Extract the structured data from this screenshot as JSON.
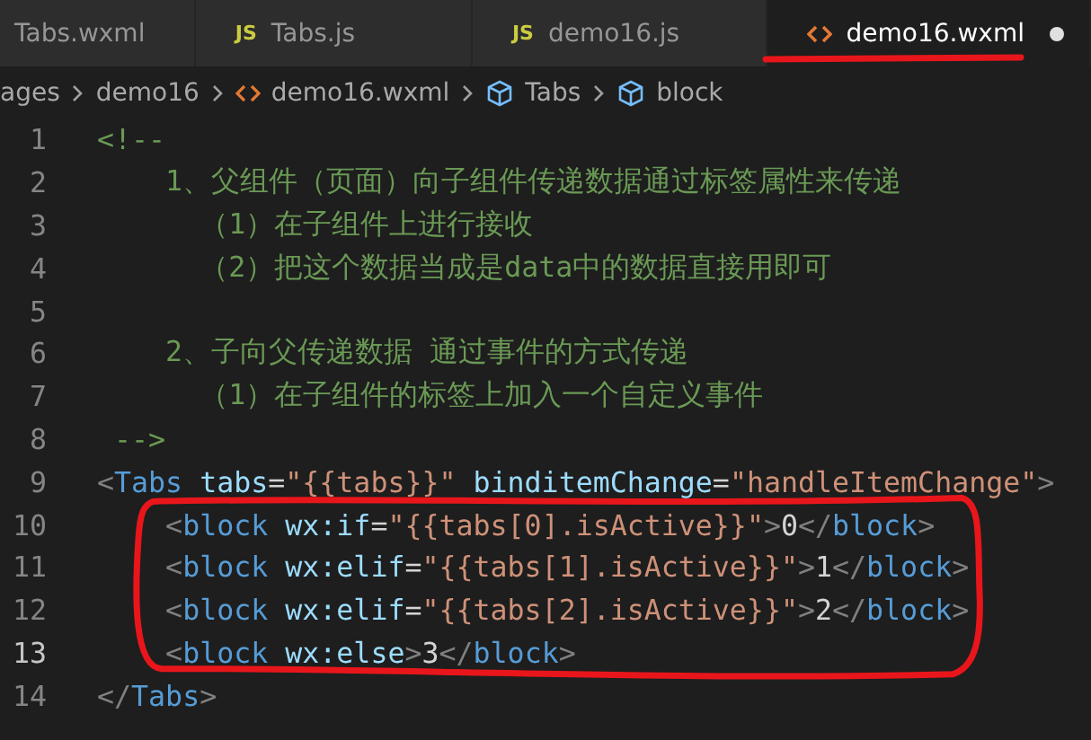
{
  "tabs": [
    {
      "kind": "plain",
      "label": "Tabs.wxml",
      "selected": false,
      "modified": false
    },
    {
      "kind": "script",
      "badge": "JS",
      "label": "Tabs.js",
      "selected": false,
      "modified": false
    },
    {
      "kind": "script",
      "badge": "JS",
      "label": "demo16.js",
      "selected": false,
      "modified": false
    },
    {
      "kind": "markup",
      "label": "demo16.wxml",
      "selected": true,
      "modified": true,
      "underlined": true
    }
  ],
  "breadcrumb": [
    {
      "kind": "folder",
      "label": "ages"
    },
    {
      "kind": "folder",
      "label": "demo16"
    },
    {
      "kind": "file",
      "label": "demo16.wxml"
    },
    {
      "kind": "symbol",
      "label": "Tabs"
    },
    {
      "kind": "symbol",
      "label": "block"
    }
  ],
  "lines": [
    {
      "number": "1",
      "current": false,
      "outlined": false,
      "tokens": [
        {
          "kind": "comment",
          "text": "<!--"
        }
      ]
    },
    {
      "number": "2",
      "current": false,
      "outlined": false,
      "tokens": [
        {
          "kind": "comment",
          "text": "    1、父组件（页面）向子组件传递数据通过标签属性来传递"
        }
      ]
    },
    {
      "number": "3",
      "current": false,
      "outlined": false,
      "tokens": [
        {
          "kind": "comment",
          "text": "      （1）在子组件上进行接收"
        }
      ]
    },
    {
      "number": "4",
      "current": false,
      "outlined": false,
      "tokens": [
        {
          "kind": "comment",
          "text": "      （2）把这个数据当成是data中的数据直接用即可"
        }
      ]
    },
    {
      "number": "5",
      "current": false,
      "outlined": false
    },
    {
      "number": "6",
      "current": false,
      "outlined": false,
      "tokens": [
        {
          "kind": "comment",
          "text": "    2、子向父传递数据 通过事件的方式传递"
        }
      ]
    },
    {
      "number": "7",
      "current": false,
      "outlined": false,
      "tokens": [
        {
          "kind": "comment",
          "text": "      （1）在子组件的标签上加入一个自定义事件"
        }
      ]
    },
    {
      "number": "8",
      "current": false,
      "outlined": false,
      "tokens": [
        {
          "kind": "comment",
          "text": " -->"
        }
      ]
    },
    {
      "number": "9",
      "current": false,
      "outlined": false,
      "tokens": [
        {
          "kind": "punct",
          "text": "<"
        },
        {
          "kind": "tag",
          "text": "Tabs"
        },
        {
          "kind": "attr",
          "text": " tabs"
        },
        {
          "kind": "text",
          "text": "="
        },
        {
          "kind": "string",
          "text": "\"{{tabs}}\""
        },
        {
          "kind": "attr",
          "text": " binditemChange"
        },
        {
          "kind": "text",
          "text": "="
        },
        {
          "kind": "string",
          "text": "\"handleItemChange\""
        },
        {
          "kind": "punct",
          "text": ">"
        }
      ]
    },
    {
      "number": "10",
      "current": false,
      "outlined": true,
      "tokens": [
        {
          "kind": "punct",
          "text": "    <"
        },
        {
          "kind": "tag",
          "text": "block"
        },
        {
          "kind": "attr",
          "text": " wx:if"
        },
        {
          "kind": "text",
          "text": "="
        },
        {
          "kind": "string",
          "text": "\"{{tabs[0].isActive}}\""
        },
        {
          "kind": "punct",
          "text": ">"
        },
        {
          "kind": "text",
          "text": "0"
        },
        {
          "kind": "punct",
          "text": "</"
        },
        {
          "kind": "tag",
          "text": "block"
        },
        {
          "kind": "punct",
          "text": ">"
        }
      ]
    },
    {
      "number": "11",
      "current": false,
      "outlined": true,
      "tokens": [
        {
          "kind": "punct",
          "text": "    <"
        },
        {
          "kind": "tag",
          "text": "block"
        },
        {
          "kind": "attr",
          "text": " wx:elif"
        },
        {
          "kind": "text",
          "text": "="
        },
        {
          "kind": "string",
          "text": "\"{{tabs[1].isActive}}\""
        },
        {
          "kind": "punct",
          "text": ">"
        },
        {
          "kind": "text",
          "text": "1"
        },
        {
          "kind": "punct",
          "text": "</"
        },
        {
          "kind": "tag",
          "text": "block"
        },
        {
          "kind": "punct",
          "text": ">"
        }
      ]
    },
    {
      "number": "12",
      "current": false,
      "outlined": true,
      "tokens": [
        {
          "kind": "punct",
          "text": "    <"
        },
        {
          "kind": "tag",
          "text": "block"
        },
        {
          "kind": "attr",
          "text": " wx:elif"
        },
        {
          "kind": "text",
          "text": "="
        },
        {
          "kind": "string",
          "text": "\"{{tabs[2].isActive}}\""
        },
        {
          "kind": "punct",
          "text": ">"
        },
        {
          "kind": "text",
          "text": "2"
        },
        {
          "kind": "punct",
          "text": "</"
        },
        {
          "kind": "tag",
          "text": "block"
        },
        {
          "kind": "punct",
          "text": ">"
        }
      ]
    },
    {
      "number": "13",
      "current": true,
      "outlined": true,
      "tokens": [
        {
          "kind": "punct",
          "text": "    <"
        },
        {
          "kind": "tag",
          "text": "block"
        },
        {
          "kind": "attr",
          "text": " wx:else"
        },
        {
          "kind": "punct",
          "text": ">"
        },
        {
          "kind": "text",
          "text": "3"
        },
        {
          "kind": "punct",
          "text": "</"
        },
        {
          "kind": "tag",
          "text": "block"
        },
        {
          "kind": "punct",
          "text": ">"
        }
      ]
    },
    {
      "number": "14",
      "current": false,
      "outlined": false,
      "tokens": [
        {
          "kind": "punct",
          "text": "</"
        },
        {
          "kind": "tag",
          "text": "Tabs"
        },
        {
          "kind": "punct",
          "text": ">"
        }
      ]
    }
  ]
}
